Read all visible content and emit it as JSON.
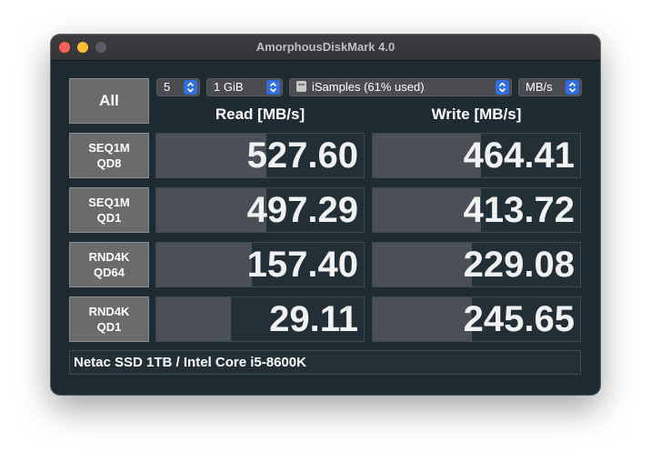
{
  "window": {
    "title": "AmorphousDiskMark 4.0"
  },
  "controls": {
    "all_label": "All",
    "count": "5",
    "size": "1 GiB",
    "drive": "iSamples (61% used)",
    "unit": "MB/s"
  },
  "headers": {
    "read": "Read [MB/s]",
    "write": "Write [MB/s]"
  },
  "rows": [
    {
      "line1": "SEQ1M",
      "line2": "QD8",
      "read": "527.60",
      "write": "464.41",
      "read_fill": 0.53,
      "write_fill": 0.52
    },
    {
      "line1": "SEQ1M",
      "line2": "QD1",
      "read": "497.29",
      "write": "413.72",
      "read_fill": 0.53,
      "write_fill": 0.52
    },
    {
      "line1": "RND4K",
      "line2": "QD64",
      "read": "157.40",
      "write": "229.08",
      "read_fill": 0.46,
      "write_fill": 0.48
    },
    {
      "line1": "RND4K",
      "line2": "QD1",
      "read": "29.11",
      "write": "245.65",
      "read_fill": 0.36,
      "write_fill": 0.48
    }
  ],
  "comment": "Netac SSD 1TB / Intel Core i5-8600K",
  "colors": {
    "window_bg": "#1f2b33",
    "bar_fill": "#4a5056",
    "accent_blue": "#2f6fe0"
  }
}
